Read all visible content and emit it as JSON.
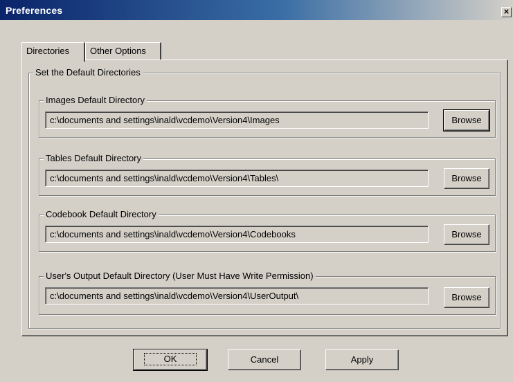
{
  "window": {
    "title": "Preferences",
    "close_glyph": "×"
  },
  "tabs": [
    {
      "label": "Directories",
      "active": true
    },
    {
      "label": "Other Options",
      "active": false
    }
  ],
  "main_group": {
    "label": "Set the Default Directories"
  },
  "groups": [
    {
      "label": "Images Default Directory",
      "path": "c:\\documents and settings\\inald\\vcdemo\\Version4\\Images",
      "button": "Browse"
    },
    {
      "label": "Tables Default Directory",
      "path": "c:\\documents and settings\\inald\\vcdemo\\Version4\\Tables\\",
      "button": "Browse"
    },
    {
      "label": "Codebook Default Directory",
      "path": "c:\\documents and settings\\inald\\vcdemo\\Version4\\Codebooks",
      "button": "Browse"
    },
    {
      "label": "User's Output Default Directory (User Must Have Write Permission)",
      "path": "c:\\documents and settings\\inald\\vcdemo\\Version4\\UserOutput\\",
      "button": "Browse"
    }
  ],
  "footer": {
    "ok": "OK",
    "cancel": "Cancel",
    "apply": "Apply"
  }
}
